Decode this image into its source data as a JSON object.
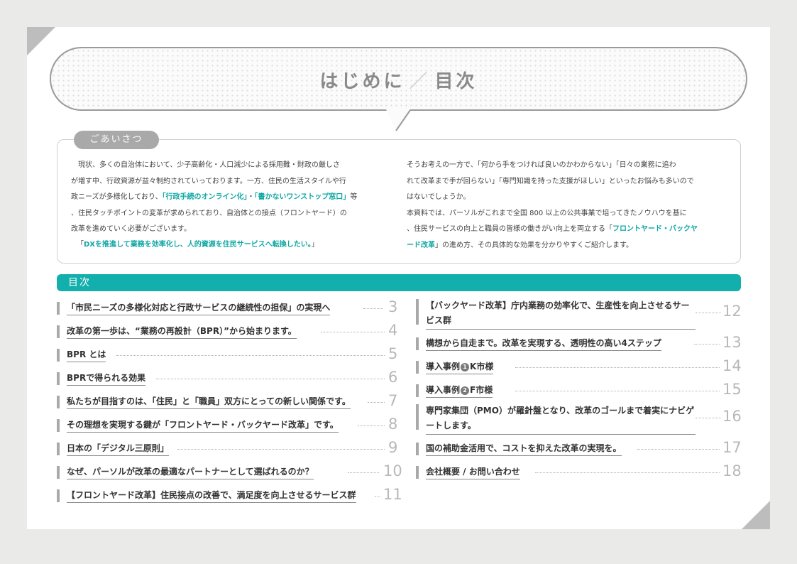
{
  "title": {
    "main": "はじめに",
    "slash": "／",
    "sub": "目次"
  },
  "greeting": {
    "tab": "ごあいさつ",
    "left": {
      "l1": "　現状、多くの自治体において、少子高齢化・人口減少による採用難・財政の厳しさ",
      "l2": "が増す中、行政資源が益々制約されていっております。一方、住民の生活スタイルや行",
      "l3a": "政ニーズが多様化しており、",
      "l3h1": "「行政手続のオンライン化」",
      "l3b": "・",
      "l3h2": "「書かないワンストップ窓口」",
      "l3c": "等",
      "l4": "、住民タッチポイントの変革が求められており、自治体との接点（フロントヤード）の",
      "l5": "改革を進めていく必要がございます。"
    },
    "quote": {
      "open": "「",
      "text": "DXを推進して業務を効率化し、人的資源を住民サービスへ転換したい。",
      "close": "」"
    },
    "right": {
      "l1": "そうお考えの一方で、「何から手をつければ良いのかわからない」「日々の業務に追わ",
      "l2": "れて改革まで手が回らない」「専門知識を持った支援がほしい」といったお悩みも多いので",
      "l3": "はないでしょうか。",
      "l4": "本資料では、パーソルがこれまで全国 800 以上の公共事業で培ってきたノウハウを基に",
      "l5a": "、住民サービスの向上と職員の皆様の働きがい向上を両立する「",
      "l5h": "フロントヤード・バックヤ",
      "l6h": "ード改革",
      "l6a": "」の進め方、その具体的な効果を分かりやすくご紹介します。"
    }
  },
  "toc": {
    "heading": "目次",
    "left": [
      {
        "label": "「市民ニーズの多様化対応と行政サービスの継続性の担保」の実現へ",
        "page": "3"
      },
      {
        "label": "改革の第一歩は、“業務の再設計（BPR）”から始まります。",
        "page": "4"
      },
      {
        "label": "BPR とは",
        "page": "5"
      },
      {
        "label": "BPRで得られる効果",
        "page": "6"
      },
      {
        "label": "私たちが目指すのは、「住民」と「職員」双方にとっての新しい関係です。",
        "page": "7"
      },
      {
        "label": "その理想を実現する鍵が「フロントヤード・バックヤード改革」です。",
        "page": "8"
      },
      {
        "label": "日本の「デジタル三原則」",
        "page": "9"
      },
      {
        "label": "なぜ、パーソルが改革の最適なパートナーとして選ばれるのか？",
        "page": "10"
      },
      {
        "label": "【フロントヤード改革】住民接点の改善で、満足度を向上させるサービス群",
        "page": "11"
      }
    ],
    "right": [
      {
        "label": "【バックヤード改革】庁内業務の効率化で、生産性を向上させるサービス群",
        "page": "12"
      },
      {
        "label": "構想から自走まで。改革を実現する、透明性の高い4ステップ",
        "page": "13"
      },
      {
        "label_a": "導入事例",
        "badge": "1",
        "label_b": "K市様",
        "page": "14"
      },
      {
        "label_a": "導入事例",
        "badge": "2",
        "label_b": "F市様",
        "page": "15"
      },
      {
        "label": "専門家集団（PMO）が羅針盤となり、改革のゴールまで着実にナビゲートします。",
        "page": "16"
      },
      {
        "label": "国の補助金活用で、コストを抑えた改革の実現を。",
        "page": "17"
      },
      {
        "label": "会社概要 / お問い合わせ",
        "page": "18"
      }
    ]
  },
  "colors": {
    "accent": "#13afac",
    "highlight": "#0fa7a4",
    "gray": "#a9a9a9"
  }
}
